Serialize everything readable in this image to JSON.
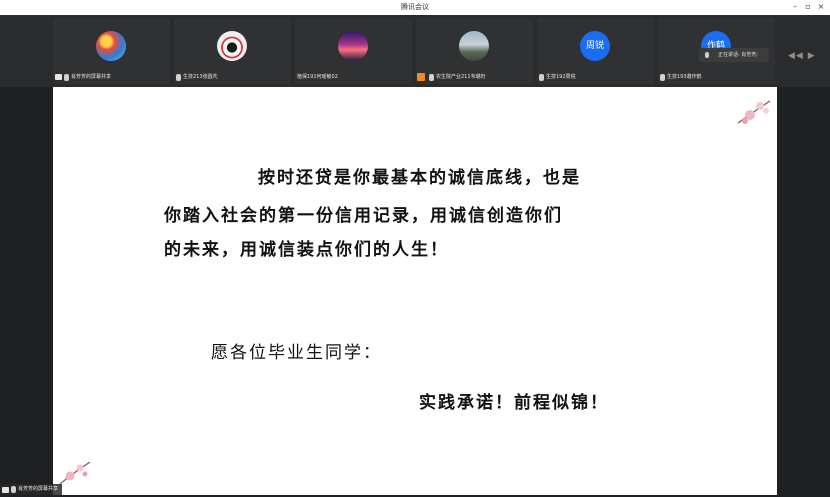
{
  "window": {
    "title": "腾讯会议",
    "minimize": "–",
    "maximize": "▫",
    "close": "×"
  },
  "participants": [
    {
      "name": "肖芳芳的屏幕共享",
      "avatar_text": ""
    },
    {
      "name": "生技213张圆芃",
      "avatar_text": ""
    },
    {
      "name": "植保191何瑶敏02",
      "avatar_text": ""
    },
    {
      "name": "农生院产业211韦璐珩",
      "avatar_text": ""
    },
    {
      "name": "生技192周锐",
      "avatar_text": "周锐"
    },
    {
      "name": "生技193邀作鹤",
      "avatar_text": "作鹤"
    }
  ],
  "speaking": {
    "text": "正在讲话: 肖芳芳;"
  },
  "nav": {
    "arrows": "◀◀ ▶"
  },
  "slide": {
    "line1": "按时还贷是你最基本的诚信底线，也是",
    "line2": "你踏入社会的第一份信用记录，用诚信创造你们",
    "line3": "的未来，用诚信装点你们的人生！",
    "line4": "愿各位毕业生同学：",
    "line5": "实践承诺！前程似锦！"
  },
  "bottom_bar": {
    "label": "肖芳芳的屏幕共享"
  },
  "colors": {
    "accent_blue": "#1a6cf0",
    "role_orange": "#f08c1f"
  }
}
